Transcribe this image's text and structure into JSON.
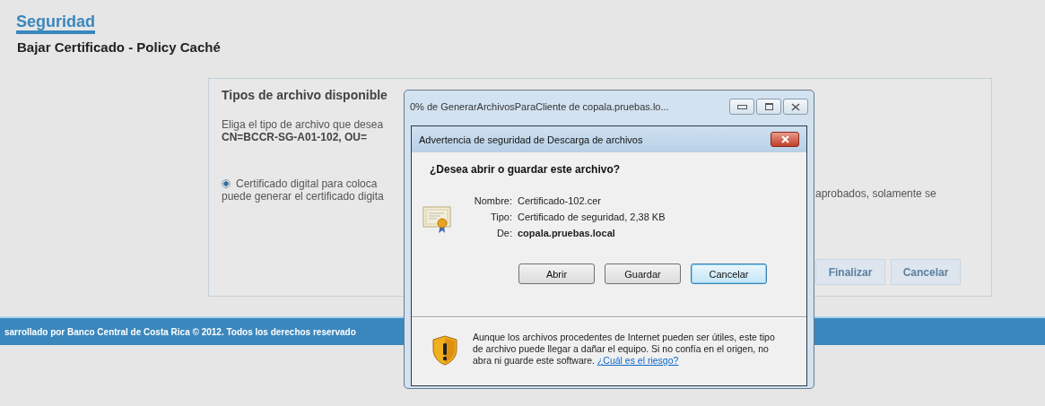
{
  "page": {
    "title": "Seguridad",
    "subtitle": "Bajar Certificado - Policy Caché"
  },
  "panel": {
    "title": "Tipos de archivo disponible",
    "description": "Eliga el tipo de archivo que desea",
    "subject": "CN=BCCR-SG-A01-102, OU=",
    "options": [
      {
        "lines": [
          "Certificado digital para coloca",
          "puede generar el certificado digita"
        ],
        "selected": true
      }
    ],
    "right_text": "aprobados, solamente se",
    "buttons": [
      "Finalizar",
      "Cancelar"
    ]
  },
  "footer": "sarrollado por Banco Central de Costa Rica © 2012. Todos los derechos reservado",
  "download_window": {
    "title": "0% de GenerarArchivosParaCliente de copala.pruebas.lo..."
  },
  "security_dialog": {
    "title": "Advertencia de seguridad de Descarga de archivos",
    "question": "¿Desea abrir o guardar este archivo?",
    "fields": [
      {
        "label": "Nombre:",
        "value": "Certificado-102.cer",
        "bold": false
      },
      {
        "label": "Tipo:",
        "value": "Certificado de seguridad, 2,38 KB",
        "bold": false
      },
      {
        "label": "De:",
        "value": "copala.pruebas.local",
        "bold": true
      }
    ],
    "buttons": [
      {
        "label": "Abrir",
        "focused": false
      },
      {
        "label": "Guardar",
        "focused": false
      },
      {
        "label": "Cancelar",
        "focused": true
      }
    ],
    "warning": "Aunque los archivos procedentes de Internet pueden ser útiles, este tipo de archivo puede llegar a dañar el equipo. Si no confía en el origen, no abra ni guarde este software.",
    "link": "¿Cuál es el riesgo?"
  }
}
